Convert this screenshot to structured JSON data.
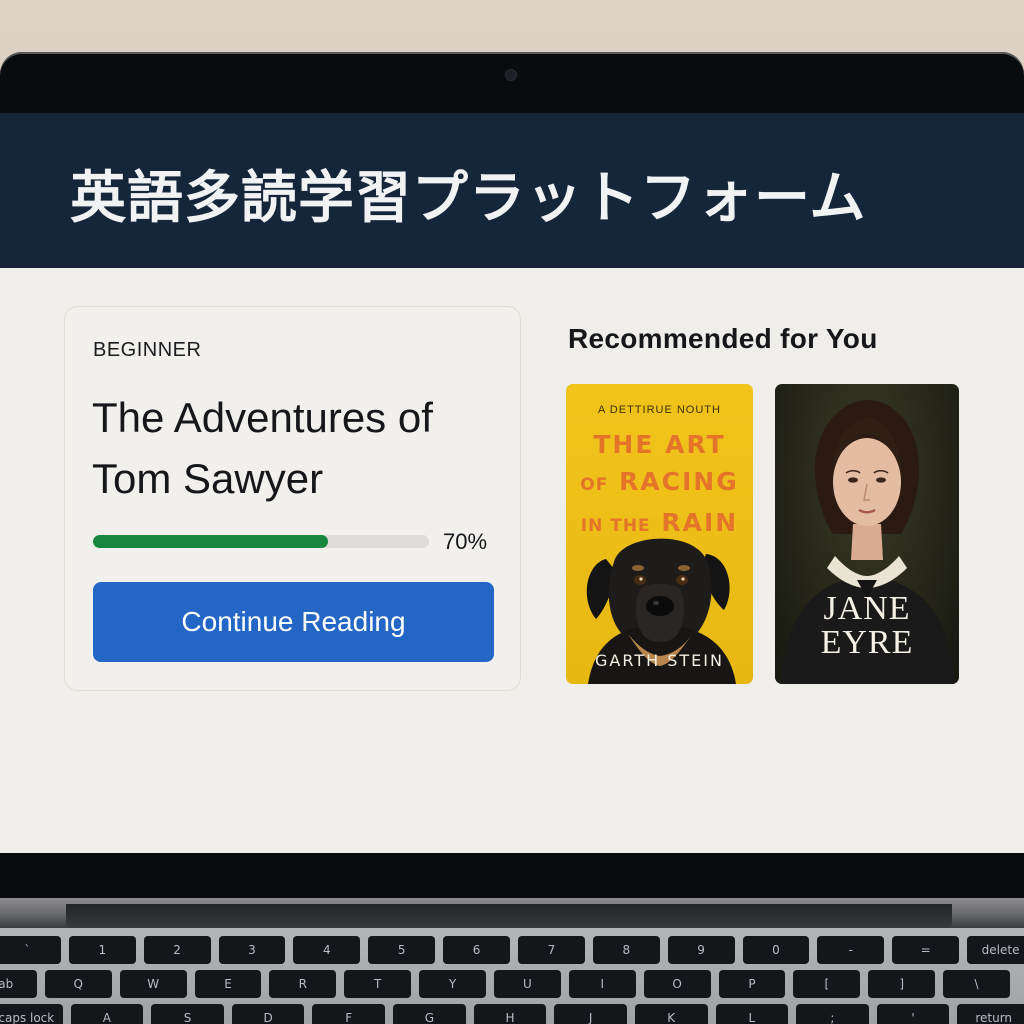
{
  "app": {
    "title": "英語多読学習プラットフォーム"
  },
  "current_book": {
    "level": "BEGINNER",
    "title": "The Adventures of Tom Sawyer",
    "progress": 0.7,
    "progress_label": "70%",
    "continue_label": "Continue Reading"
  },
  "recommended": {
    "heading": "Recommended for You",
    "books": [
      {
        "cover_subtitle": "A DETTIRUE NOUTH",
        "cover_title_line1": "THE ART",
        "cover_title_of": "OF",
        "cover_title_line2": "RACING",
        "cover_title_in": "IN THE",
        "cover_title_line3": "RAIN",
        "author": "GARTH STEIN",
        "cover_color": "#f1c41c",
        "title_color": "#e5742b",
        "illustration": "dog-illustration"
      },
      {
        "cover_title_line1": "JANE",
        "cover_title_line2": "EYRE",
        "cover_color": "#262719",
        "illustration": "woman-portrait-illustration"
      }
    ]
  },
  "colors": {
    "header_bg": "#15263a",
    "accent_button": "#2366c6",
    "progress_fill": "#18873e",
    "screen_bg": "#efeeea"
  },
  "keyboard": {
    "row1": [
      "⎋",
      "☼",
      "☀",
      "⊞",
      "⌕",
      "🎤",
      "☾",
      "◀◀",
      "▶‖",
      "▶▶",
      "◁",
      "◁)",
      "◁))"
    ],
    "row2": [
      "`",
      "1",
      "2",
      "3",
      "4",
      "5",
      "6",
      "7",
      "8",
      "9",
      "0",
      "-",
      "=",
      "delete"
    ],
    "row3": [
      "tab",
      "Q",
      "W",
      "E",
      "R",
      "T",
      "Y",
      "U",
      "I",
      "O",
      "P",
      "[",
      "]",
      "\\"
    ],
    "row4": [
      "caps lock",
      "A",
      "S",
      "D",
      "F",
      "G",
      "H",
      "J",
      "K",
      "L",
      ";",
      "'",
      "return"
    ]
  }
}
